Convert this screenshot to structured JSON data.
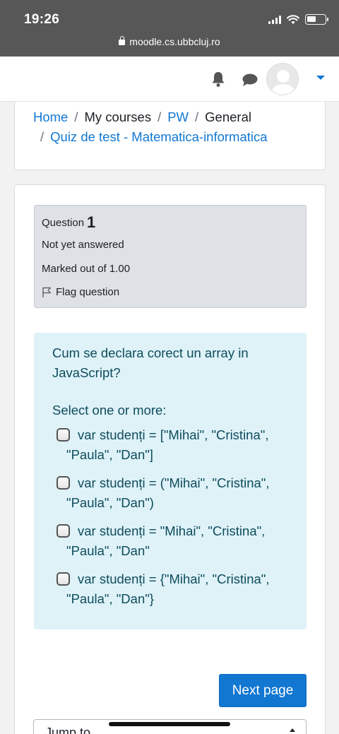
{
  "status_bar": {
    "time": "19:26",
    "url": "moodle.cs.ubbcluj.ro"
  },
  "navbar": {
    "icons": [
      "bell-icon",
      "chat-icon",
      "avatar",
      "caret-down-icon"
    ]
  },
  "breadcrumb": {
    "home": "Home",
    "my_courses": "My courses",
    "course": "PW",
    "section": "General",
    "quiz": "Quiz de test - Matematica-informatica",
    "separator": "/"
  },
  "question_info": {
    "label": "Question",
    "number": "1",
    "state": "Not yet answered",
    "mark": "Marked out of 1.00",
    "flag": "Flag question"
  },
  "question": {
    "text": "Cum se declara corect un array in JavaScript?",
    "prompt": "Select one or more:",
    "answers": [
      {
        "line1": "var studenți = [\"Mihai\", \"Cristina\",",
        "line2": "\"Paula\", \"Dan\"]",
        "checked": false
      },
      {
        "line1": "var studenți = (\"Mihai\", \"Cristina\",",
        "line2": "\"Paula\", \"Dan\")",
        "checked": false
      },
      {
        "line1": "var studenți = \"Mihai\", \"Cristina\",",
        "line2": "\"Paula\", \"Dan\"",
        "checked": false
      },
      {
        "line1": "var studenți = {\"Mihai\", \"Cristina\",",
        "line2": "\"Paula\", \"Dan\"}",
        "checked": false
      }
    ]
  },
  "actions": {
    "next_page": "Next page",
    "jump_to": "Jump to..."
  },
  "colors": {
    "link": "#1177d1",
    "info_bg": "#dee2e6",
    "formulation_bg": "#def2f8",
    "button": "#1177d1"
  }
}
